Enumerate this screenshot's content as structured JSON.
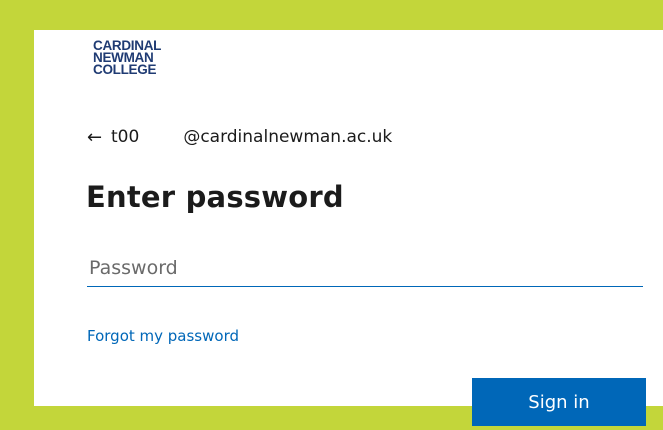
{
  "colors": {
    "frame_accent": "#c3d63a",
    "primary_blue": "#0067b8",
    "logo_navy": "#1f3b73"
  },
  "logo": {
    "line1": "CARDINAL",
    "line2": "NEWMAN",
    "line3": "COLLEGE"
  },
  "identity": {
    "back_icon": "←",
    "user_prefix": "t00",
    "user_domain": "@cardinalnewman.ac.uk"
  },
  "title": "Enter password",
  "password": {
    "placeholder": "Password",
    "value": ""
  },
  "links": {
    "forgot": "Forgot my password"
  },
  "buttons": {
    "sign_in": "Sign in"
  }
}
